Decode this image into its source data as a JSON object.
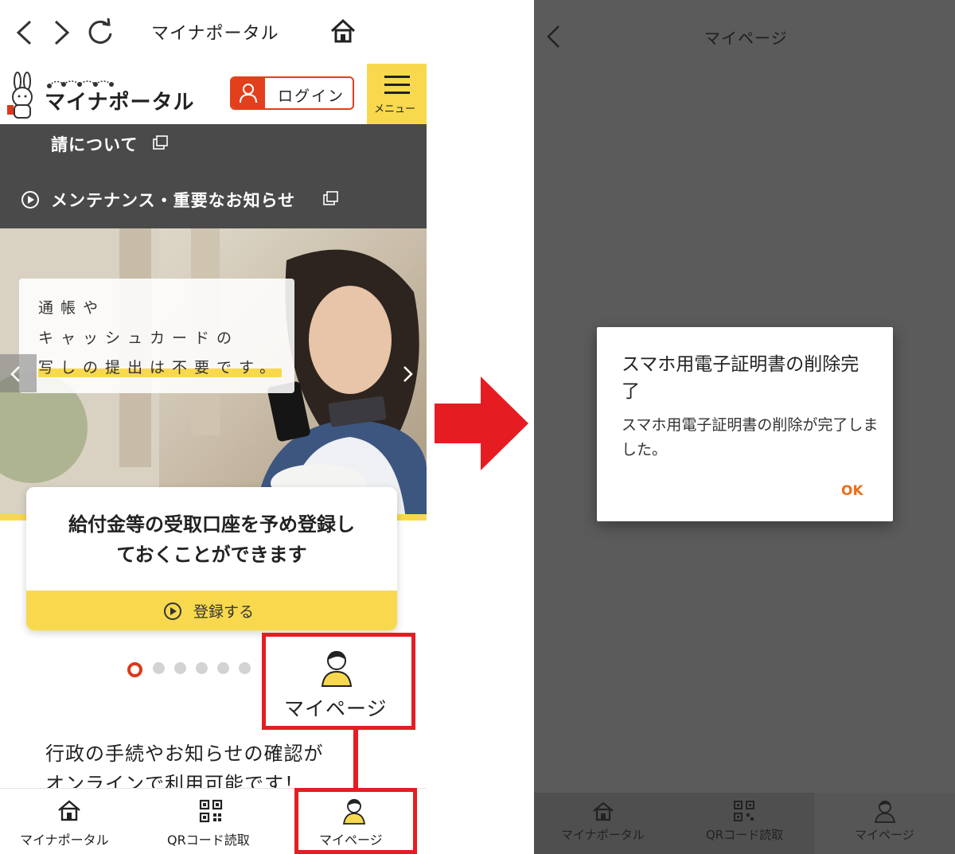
{
  "left": {
    "browser": {
      "title": "マイナポータル"
    },
    "header": {
      "logo_text": "マイナポータル",
      "login_label": "ログイン",
      "menu_label": "メニュー"
    },
    "dark_band": {
      "item1": "請について",
      "item2": "メンテナンス・重要なお知らせ"
    },
    "hero": {
      "callout_lines": [
        "通帳や",
        "キャッシュカードの",
        "写しの提出は不要です。"
      ]
    },
    "card": {
      "title_line1": "給付金等の受取口座を予め登録し",
      "title_line2": "ておくことができます",
      "button_label": "登録する"
    },
    "carousel": {
      "total_dots": 6,
      "active_index": 0
    },
    "mypage_callout": {
      "label": "マイページ"
    },
    "body": {
      "line1": "行政の手続やお知らせの確認が",
      "line2": "オンラインで利用可能です！"
    },
    "tabbar": {
      "tabs": [
        {
          "label": "マイナポータル",
          "icon": "house-icon"
        },
        {
          "label": "QRコード読取",
          "icon": "qr-code-icon"
        },
        {
          "label": "マイページ",
          "icon": "person-icon"
        }
      ]
    }
  },
  "right": {
    "header": {
      "title": "マイページ"
    },
    "dialog": {
      "title": "スマホ用電子証明書の削除完了",
      "message": "スマホ用電子証明書の削除が完了しました。",
      "ok_label": "OK"
    },
    "tabbar": {
      "tabs": [
        {
          "label": "マイナポータル",
          "icon": "house-icon"
        },
        {
          "label": "QRコード読取",
          "icon": "qr-code-icon"
        },
        {
          "label": "マイページ",
          "icon": "person-icon"
        }
      ]
    }
  },
  "colors": {
    "brand_yellow": "#f8d94e",
    "login_red": "#e2401c",
    "highlight_red": "#e51d22",
    "ok_orange": "#ef6c1a",
    "overlay_gray": "#5b5b5b"
  }
}
